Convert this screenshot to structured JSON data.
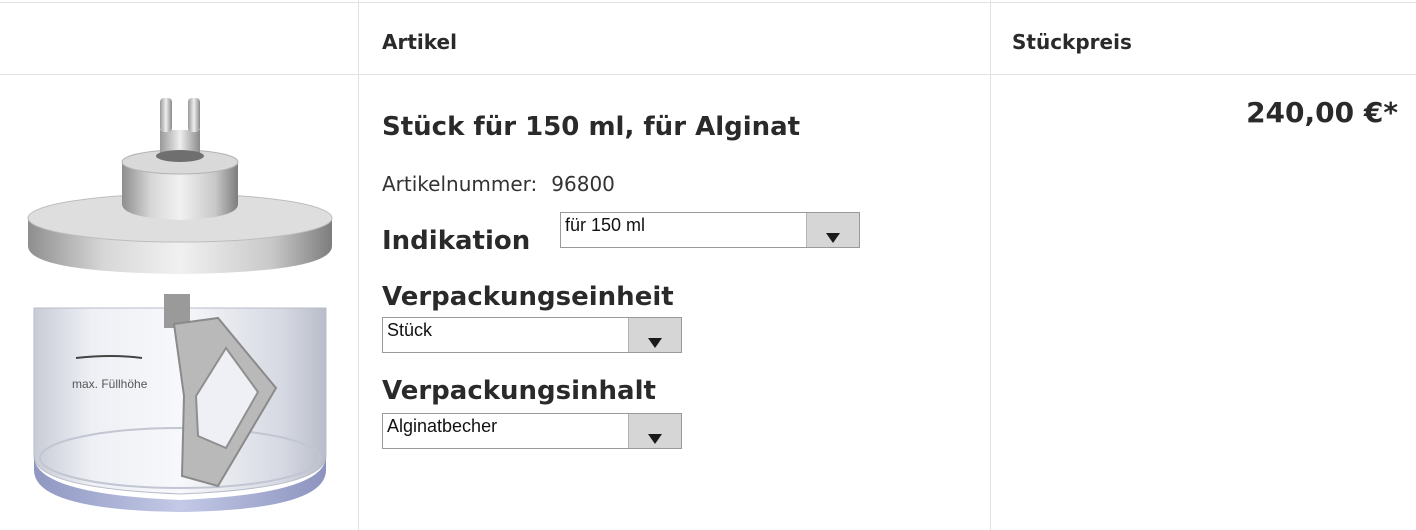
{
  "table": {
    "headers": {
      "article": "Artikel",
      "unit_price": "Stückpreis"
    }
  },
  "product": {
    "title": "Stück für 150 ml, für Alginat",
    "article_number_label": "Artikelnummer:",
    "article_number": "96800",
    "image_text": "max. Füllhöhe",
    "price": "240,00 €*"
  },
  "options": {
    "indikation": {
      "label": "Indikation",
      "selected": "für 150 ml"
    },
    "verpackungseinheit": {
      "label": "Verpackungseinheit",
      "selected": "Stück"
    },
    "verpackungsinhalt": {
      "label": "Verpackungsinhalt",
      "selected": "Alginatbecher"
    }
  },
  "icons": {
    "dropdown": "triangle-down-icon"
  }
}
